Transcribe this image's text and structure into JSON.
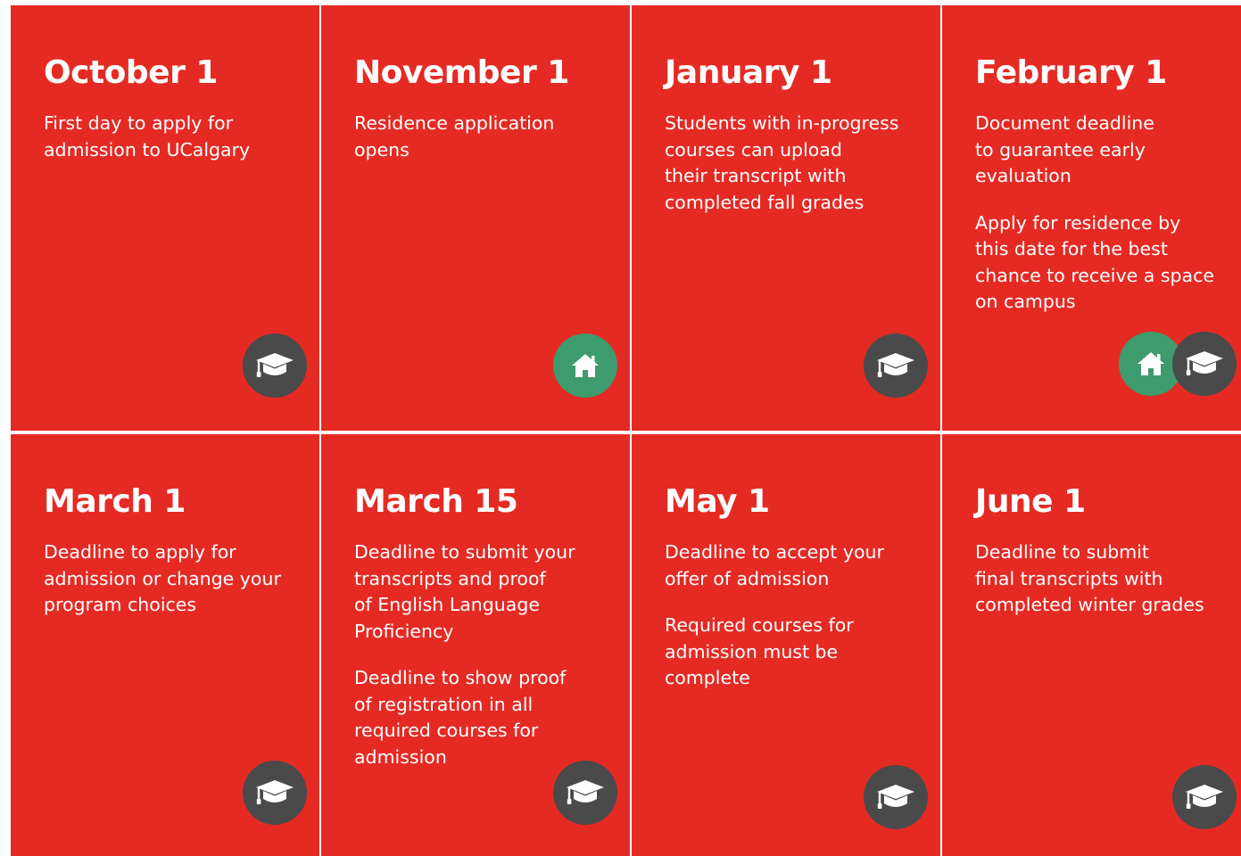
{
  "colors": {
    "card_bg": "#e52a24",
    "text": "#ffffff",
    "divider": "#ffffff",
    "grad_icon_bg": "#4a4a4a",
    "home_icon_bg": "#3e9b6e"
  },
  "cards": [
    {
      "date": "October 1",
      "paragraphs": [
        "First day to apply for\nadmission to UCalgary"
      ],
      "icons": [
        "graduation-cap-icon"
      ]
    },
    {
      "date": "November 1",
      "paragraphs": [
        "Residence application\nopens"
      ],
      "icons": [
        "home-icon"
      ]
    },
    {
      "date": "January 1",
      "paragraphs": [
        "Students with in-progress\ncourses can upload\ntheir transcript with\ncompleted fall grades"
      ],
      "icons": [
        "graduation-cap-icon"
      ]
    },
    {
      "date": "February 1",
      "paragraphs": [
        "Document deadline\nto guarantee early\nevaluation",
        "Apply for residence by\nthis date for the best\nchance to receive a space\non campus"
      ],
      "icons": [
        "home-icon",
        "graduation-cap-icon"
      ]
    },
    {
      "date": "March 1",
      "paragraphs": [
        "Deadline to apply for\nadmission or change your\nprogram choices"
      ],
      "icons": [
        "graduation-cap-icon"
      ]
    },
    {
      "date": "March 15",
      "paragraphs": [
        "Deadline to submit your\ntranscripts and proof\nof English Language\nProficiency",
        "Deadline to show proof\nof registration in all\nrequired courses for\nadmission"
      ],
      "icons": [
        "graduation-cap-icon"
      ]
    },
    {
      "date": "May 1",
      "paragraphs": [
        "Deadline to accept your\noffer of admission",
        "Required courses for\nadmission must be\ncomplete"
      ],
      "icons": [
        "graduation-cap-icon"
      ]
    },
    {
      "date": "June 1",
      "paragraphs": [
        "Deadline to submit\nfinal transcripts with\ncompleted winter grades"
      ],
      "icons": [
        "graduation-cap-icon"
      ]
    }
  ]
}
